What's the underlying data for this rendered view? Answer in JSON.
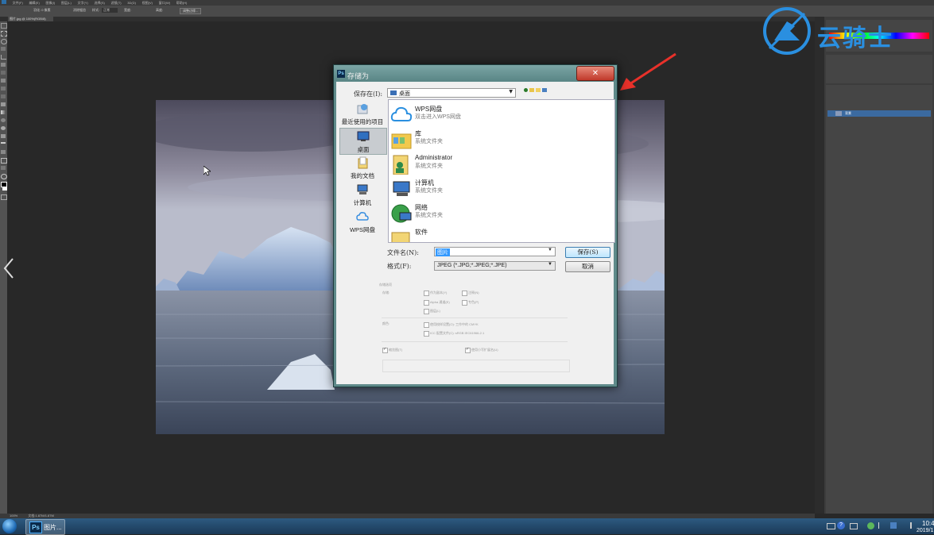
{
  "photoshop": {
    "menus": [
      "文件(F)",
      "编辑(E)",
      "图像(I)",
      "图层(L)",
      "文字(Y)",
      "选择(S)",
      "滤镜(T)",
      "3D(D)",
      "视图(V)",
      "窗口(W)",
      "帮助(H)"
    ],
    "options": {
      "feather": "羽化: 0 像素",
      "antialias": "消除锯齿",
      "style": "样式:",
      "style_value": "正常",
      "width": "宽度:",
      "height": "高度:",
      "refine": "调整边缘..."
    },
    "doc_tab": "图片.jpg @ 100%(RGB/8)",
    "status": {
      "zoom": "100%",
      "docsize": "文档:1.87M/1.87M"
    },
    "layers_panel": {
      "layer_name": "背景"
    }
  },
  "dialog": {
    "title": "存储为",
    "close_glyph": "✕",
    "lookin_label": "保存在(I):",
    "lookin_value": "桌面",
    "places": [
      {
        "label": "最近使用的项目",
        "icon": "recent-places-icon"
      },
      {
        "label": "桌面",
        "icon": "desktop-icon",
        "selected": true
      },
      {
        "label": "我的文档",
        "icon": "documents-icon"
      },
      {
        "label": "计算机",
        "icon": "computer-icon"
      },
      {
        "label": "WPS网盘",
        "icon": "cloud-icon"
      }
    ],
    "files": [
      {
        "name": "WPS网盘",
        "sub": "双击进入WPS网盘",
        "icon": "cloud-icon"
      },
      {
        "name": "库",
        "sub": "系统文件夹",
        "icon": "library-icon"
      },
      {
        "name": "Administrator",
        "sub": "系统文件夹",
        "icon": "user-folder-icon"
      },
      {
        "name": "计算机",
        "sub": "系统文件夹",
        "icon": "computer-icon"
      },
      {
        "name": "网络",
        "sub": "系统文件夹",
        "icon": "network-icon"
      },
      {
        "name": "软件",
        "sub": "",
        "icon": "folder-icon"
      }
    ],
    "filename_label": "文件名(N):",
    "filename_value": "图片",
    "format_label": "格式(F):",
    "format_value": "JPEG (*.JPG;*.JPEG;*.JPE)",
    "save_button": "保存(S)",
    "cancel_button": "取消",
    "save_options": {
      "header": "存储选项",
      "store_label": "存储:",
      "as_copy": "作为副本(Y)",
      "notes": "注释(N)",
      "alpha": "Alpha 通道(E)",
      "spot": "专色(P)",
      "layers": "图层(L)",
      "color_label": "颜色:",
      "proof": "使用校样设置(O): 工作中的 CMYK",
      "icc": "ICC 配置文件(C): sRGB IEC61966-2.1",
      "thumbnail": "缩览图(T)",
      "lowercase": "使用小写扩展名(U)"
    }
  },
  "taskbar": {
    "ps_label": "图片...",
    "ps_icon_text": "Ps",
    "time": "10:4",
    "date": "2019/1"
  },
  "watermark": {
    "text": "云骑士"
  },
  "colors": {
    "dialog_frame": "#5f8a8a",
    "accent_arrow": "#e8312a",
    "ps_dark": "#282828",
    "logo_blue": "#2a8fe0"
  }
}
